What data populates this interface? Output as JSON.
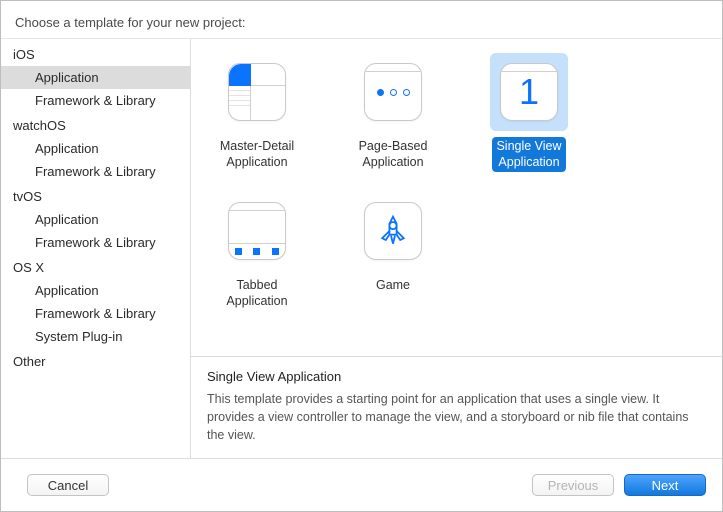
{
  "prompt": "Choose a template for your new project:",
  "sidebar": {
    "groups": [
      {
        "name": "iOS",
        "items": [
          "Application",
          "Framework & Library"
        ]
      },
      {
        "name": "watchOS",
        "items": [
          "Application",
          "Framework & Library"
        ]
      },
      {
        "name": "tvOS",
        "items": [
          "Application",
          "Framework & Library"
        ]
      },
      {
        "name": "OS X",
        "items": [
          "Application",
          "Framework & Library",
          "System Plug-in"
        ]
      },
      {
        "name": "Other",
        "items": []
      }
    ],
    "selected": {
      "group": "iOS",
      "item": "Application"
    }
  },
  "templates": [
    {
      "id": "master-detail",
      "label": "Master-Detail\nApplication",
      "selected": false
    },
    {
      "id": "page-based",
      "label": "Page-Based\nApplication",
      "selected": false
    },
    {
      "id": "single-view",
      "label": "Single View\nApplication",
      "selected": true
    },
    {
      "id": "tabbed",
      "label": "Tabbed\nApplication",
      "selected": false
    },
    {
      "id": "game",
      "label": "Game",
      "selected": false
    }
  ],
  "description": {
    "title": "Single View Application",
    "text": "This template provides a starting point for an application that uses a single view. It provides a view controller to manage the view, and a storyboard or nib file that contains the view."
  },
  "footer": {
    "cancel": "Cancel",
    "previous": "Previous",
    "next": "Next",
    "previous_enabled": false,
    "next_enabled": true
  },
  "colors": {
    "accent": "#1279db",
    "icon_blue": "#0a74ff",
    "selection_bg": "#c5e0fb",
    "sidebar_selected": "#dcdcdc"
  }
}
